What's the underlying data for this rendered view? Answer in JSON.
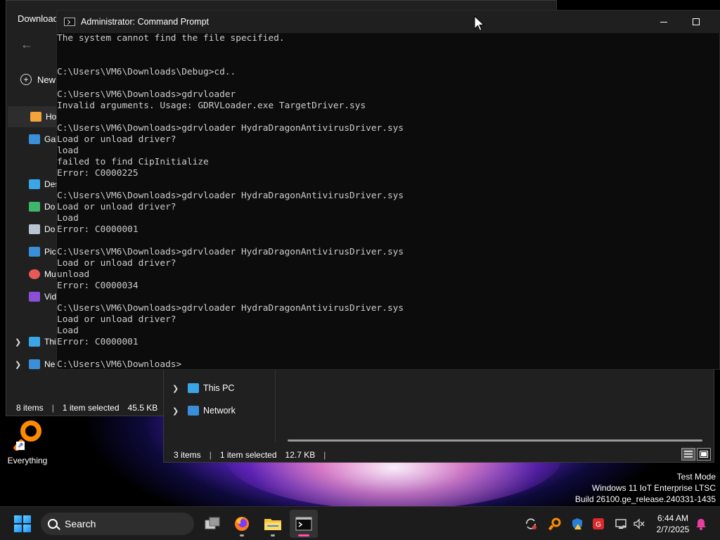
{
  "explorer_back": {
    "title": "Download",
    "new_label": "New",
    "nav_items": [
      {
        "label": "Ho",
        "icon": "home-icon",
        "color": "#f2a33a",
        "selected": true
      },
      {
        "label": "Gal",
        "icon": "gallery-icon",
        "color": "#3a8fd8"
      },
      {
        "label": "Des",
        "icon": "desktop-folder-icon",
        "color": "#3aa6e8"
      },
      {
        "label": "Do",
        "icon": "downloads-icon",
        "color": "#3fb56b"
      },
      {
        "label": "Do",
        "icon": "documents-icon",
        "color": "#b9c4d0"
      },
      {
        "label": "Pic",
        "icon": "pictures-icon",
        "color": "#3a8fd8"
      },
      {
        "label": "Mu",
        "icon": "music-icon",
        "color": "#e85a5a"
      },
      {
        "label": "Vid",
        "icon": "videos-icon",
        "color": "#8a4fd8"
      },
      {
        "label": "Thi",
        "icon": "this-pc-icon",
        "color": "#3aa6e8"
      },
      {
        "label": "Ne",
        "icon": "network-icon",
        "color": "#3a8fd8"
      }
    ],
    "status": {
      "items": "8 items",
      "selected": "1 item selected",
      "size": "45.5 KB"
    }
  },
  "explorer_front": {
    "nav_items": [
      {
        "label": "This PC",
        "icon": "this-pc-icon"
      },
      {
        "label": "Network",
        "icon": "network-icon"
      }
    ],
    "status": {
      "items": "3 items",
      "selected": "1 item selected",
      "size": "12.7 KB"
    }
  },
  "cmd": {
    "title": "Administrator: Command Prompt",
    "lines": [
      "The system cannot find the file specified.",
      "",
      "",
      "C:\\Users\\VM6\\Downloads\\Debug>cd..",
      "",
      "C:\\Users\\VM6\\Downloads>gdrvloader",
      "Invalid arguments. Usage: GDRVLoader.exe TargetDriver.sys",
      "",
      "C:\\Users\\VM6\\Downloads>gdrvloader HydraDragonAntivirusDriver.sys",
      "Load or unload driver?",
      "load",
      "failed to find CipInitialize",
      "Error: C0000225",
      "",
      "C:\\Users\\VM6\\Downloads>gdrvloader HydraDragonAntivirusDriver.sys",
      "Load or unload driver?",
      "Load",
      "Error: C0000001",
      "",
      "C:\\Users\\VM6\\Downloads>gdrvloader HydraDragonAntivirusDriver.sys",
      "Load or unload driver?",
      "unload",
      "Error: C0000034",
      "",
      "C:\\Users\\VM6\\Downloads>gdrvloader HydraDragonAntivirusDriver.sys",
      "Load or unload driver?",
      "Load",
      "Error: C0000001",
      "",
      "C:\\Users\\VM6\\Downloads>"
    ]
  },
  "desktop_icon": {
    "label": "Everything",
    "icon": "everything-search-icon"
  },
  "watermark": {
    "line1": "Test Mode",
    "line2": "Windows 11 IoT Enterprise LTSC",
    "line3": "Build 26100.ge_release.240331-1435"
  },
  "taskbar": {
    "search_label": "Search",
    "apps": [
      "task-view-icon",
      "firefox-icon",
      "file-explorer-icon",
      "terminal-icon"
    ],
    "tray_icons": [
      "sync-icon",
      "everything-tray-icon",
      "security-warning-icon",
      "antivirus-icon",
      "network-status-icon",
      "volume-muted-icon"
    ],
    "clock_time": "6:44 AM",
    "clock_date": "2/7/2025"
  }
}
